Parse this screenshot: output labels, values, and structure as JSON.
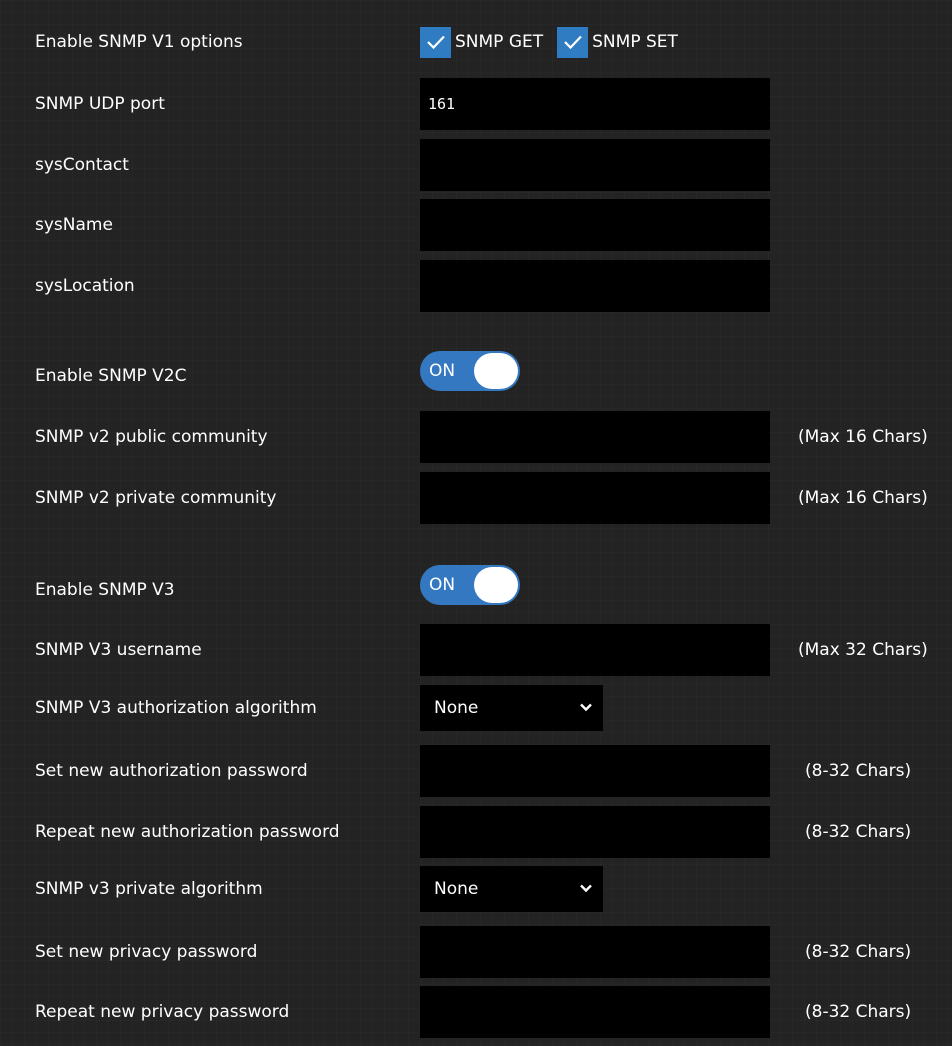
{
  "v1": {
    "label": "Enable SNMP V1 options",
    "snmp_get": {
      "label": "SNMP GET",
      "checked": true
    },
    "snmp_set": {
      "label": "SNMP SET",
      "checked": true
    }
  },
  "udp_port": {
    "label": "SNMP UDP port",
    "value": "161"
  },
  "sys_contact": {
    "label": "sysContact",
    "value": ""
  },
  "sys_name": {
    "label": "sysName",
    "value": ""
  },
  "sys_location": {
    "label": "sysLocation",
    "value": ""
  },
  "v2c": {
    "label": "Enable SNMP V2C",
    "toggle": "ON",
    "public_community": {
      "label": "SNMP v2 public community",
      "value": "",
      "hint": "(Max 16 Chars)"
    },
    "private_community": {
      "label": "SNMP v2 private community",
      "value": "",
      "hint": "(Max 16 Chars)"
    }
  },
  "v3": {
    "label": "Enable SNMP V3",
    "toggle": "ON",
    "username": {
      "label": "SNMP V3 username",
      "value": "",
      "hint": "(Max 32 Chars)"
    },
    "auth_algorithm": {
      "label": "SNMP V3 authorization algorithm",
      "selected": "None"
    },
    "auth_password": {
      "label": "Set new authorization password",
      "value": "",
      "hint": "(8-32 Chars)"
    },
    "auth_password_repeat": {
      "label": "Repeat new authorization password",
      "value": "",
      "hint": "(8-32 Chars)"
    },
    "priv_algorithm": {
      "label": "SNMP v3 private algorithm",
      "selected": "None"
    },
    "priv_password": {
      "label": "Set new privacy password",
      "value": "",
      "hint": "(8-32 Chars)"
    },
    "priv_password_repeat": {
      "label": "Repeat new privacy password",
      "value": "",
      "hint": "(8-32 Chars)"
    }
  },
  "colors": {
    "background": "#232323",
    "field": "#000000",
    "accent": "#3478c2",
    "text": "#ffffff"
  },
  "icons": {
    "checkbox": "checkmark-icon",
    "select": "chevron-down-icon"
  }
}
